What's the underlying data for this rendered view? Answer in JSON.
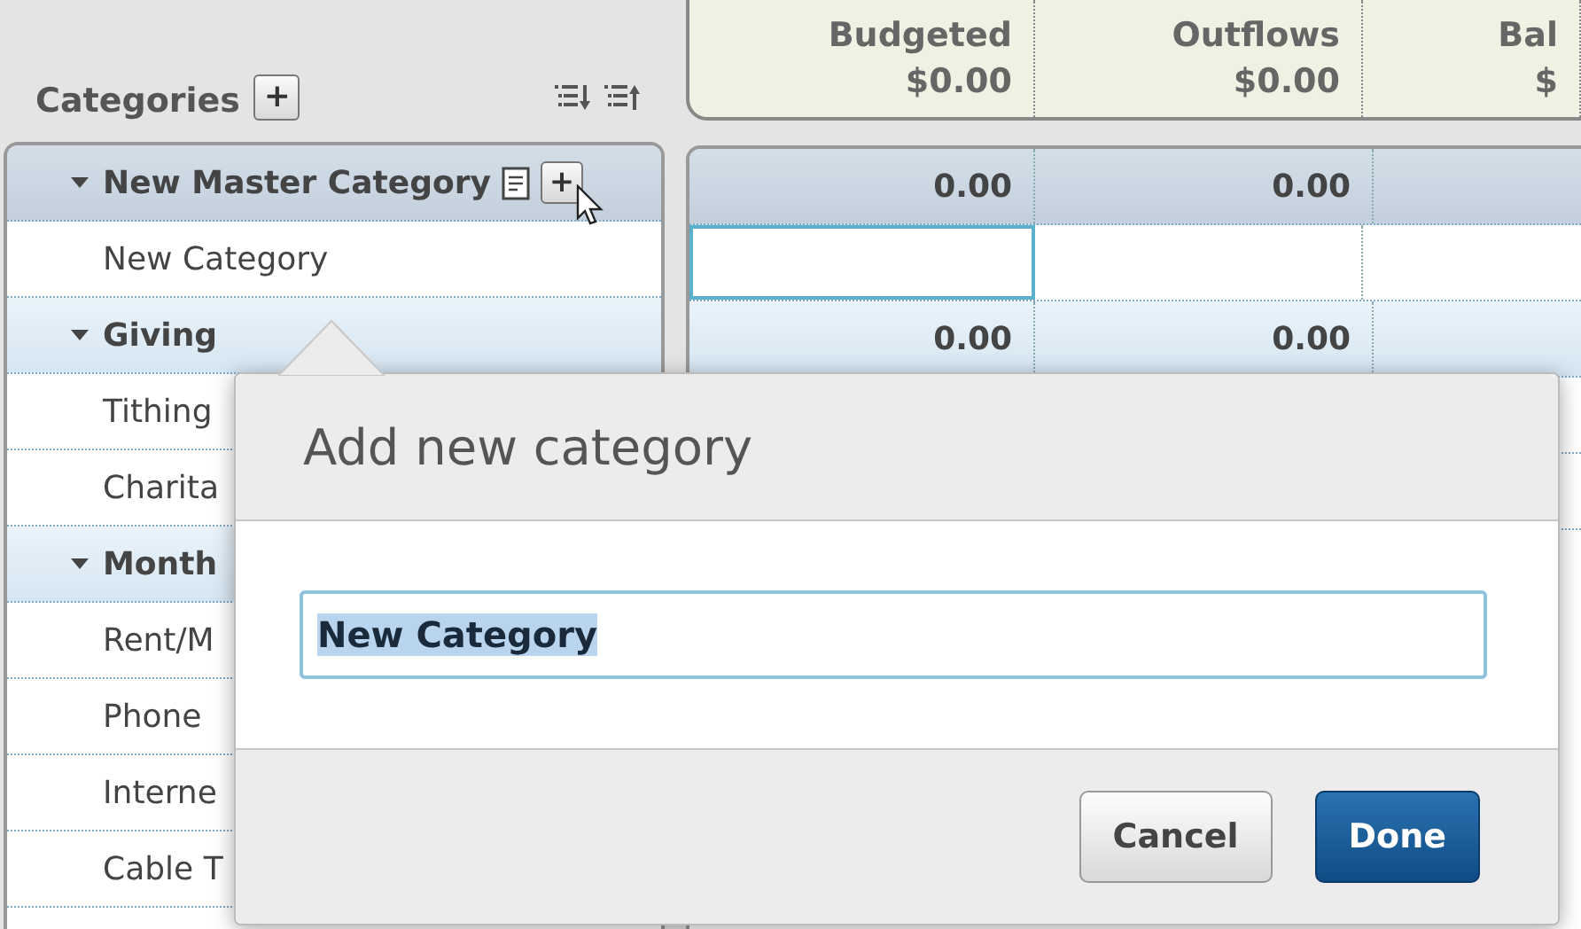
{
  "categories_panel": {
    "title": "Categories",
    "add_button": "+"
  },
  "columns": [
    {
      "label": "Budgeted",
      "total": "$0.00"
    },
    {
      "label": "Outflows",
      "total": "$0.00"
    },
    {
      "label": "Bal",
      "total": "$"
    }
  ],
  "groups": [
    {
      "name": "New Master Category",
      "expanded": true,
      "hovered": true,
      "add_button": "+",
      "budgeted": "0.00",
      "outflows": "0.00",
      "items": [
        {
          "name": "New Category",
          "selected": true
        }
      ]
    },
    {
      "name": "Giving",
      "expanded": true,
      "hovered": false,
      "budgeted": "0.00",
      "outflows": "0.00",
      "items": [
        {
          "name": "Tithing",
          "selected": false
        },
        {
          "name": "Charita",
          "selected": false
        }
      ]
    },
    {
      "name": "Month",
      "expanded": true,
      "hovered": false,
      "items": [
        {
          "name": "Rent/M",
          "selected": false
        },
        {
          "name": "Phone",
          "selected": false
        },
        {
          "name": "Interne",
          "selected": false
        },
        {
          "name": "Cable T",
          "selected": false
        }
      ]
    }
  ],
  "dialog": {
    "title": "Add new category",
    "input": {
      "value": "New Category",
      "text_selected": true
    },
    "buttons": [
      {
        "label": "Cancel",
        "kind": "secondary"
      },
      {
        "label": "Done",
        "kind": "primary"
      }
    ]
  }
}
